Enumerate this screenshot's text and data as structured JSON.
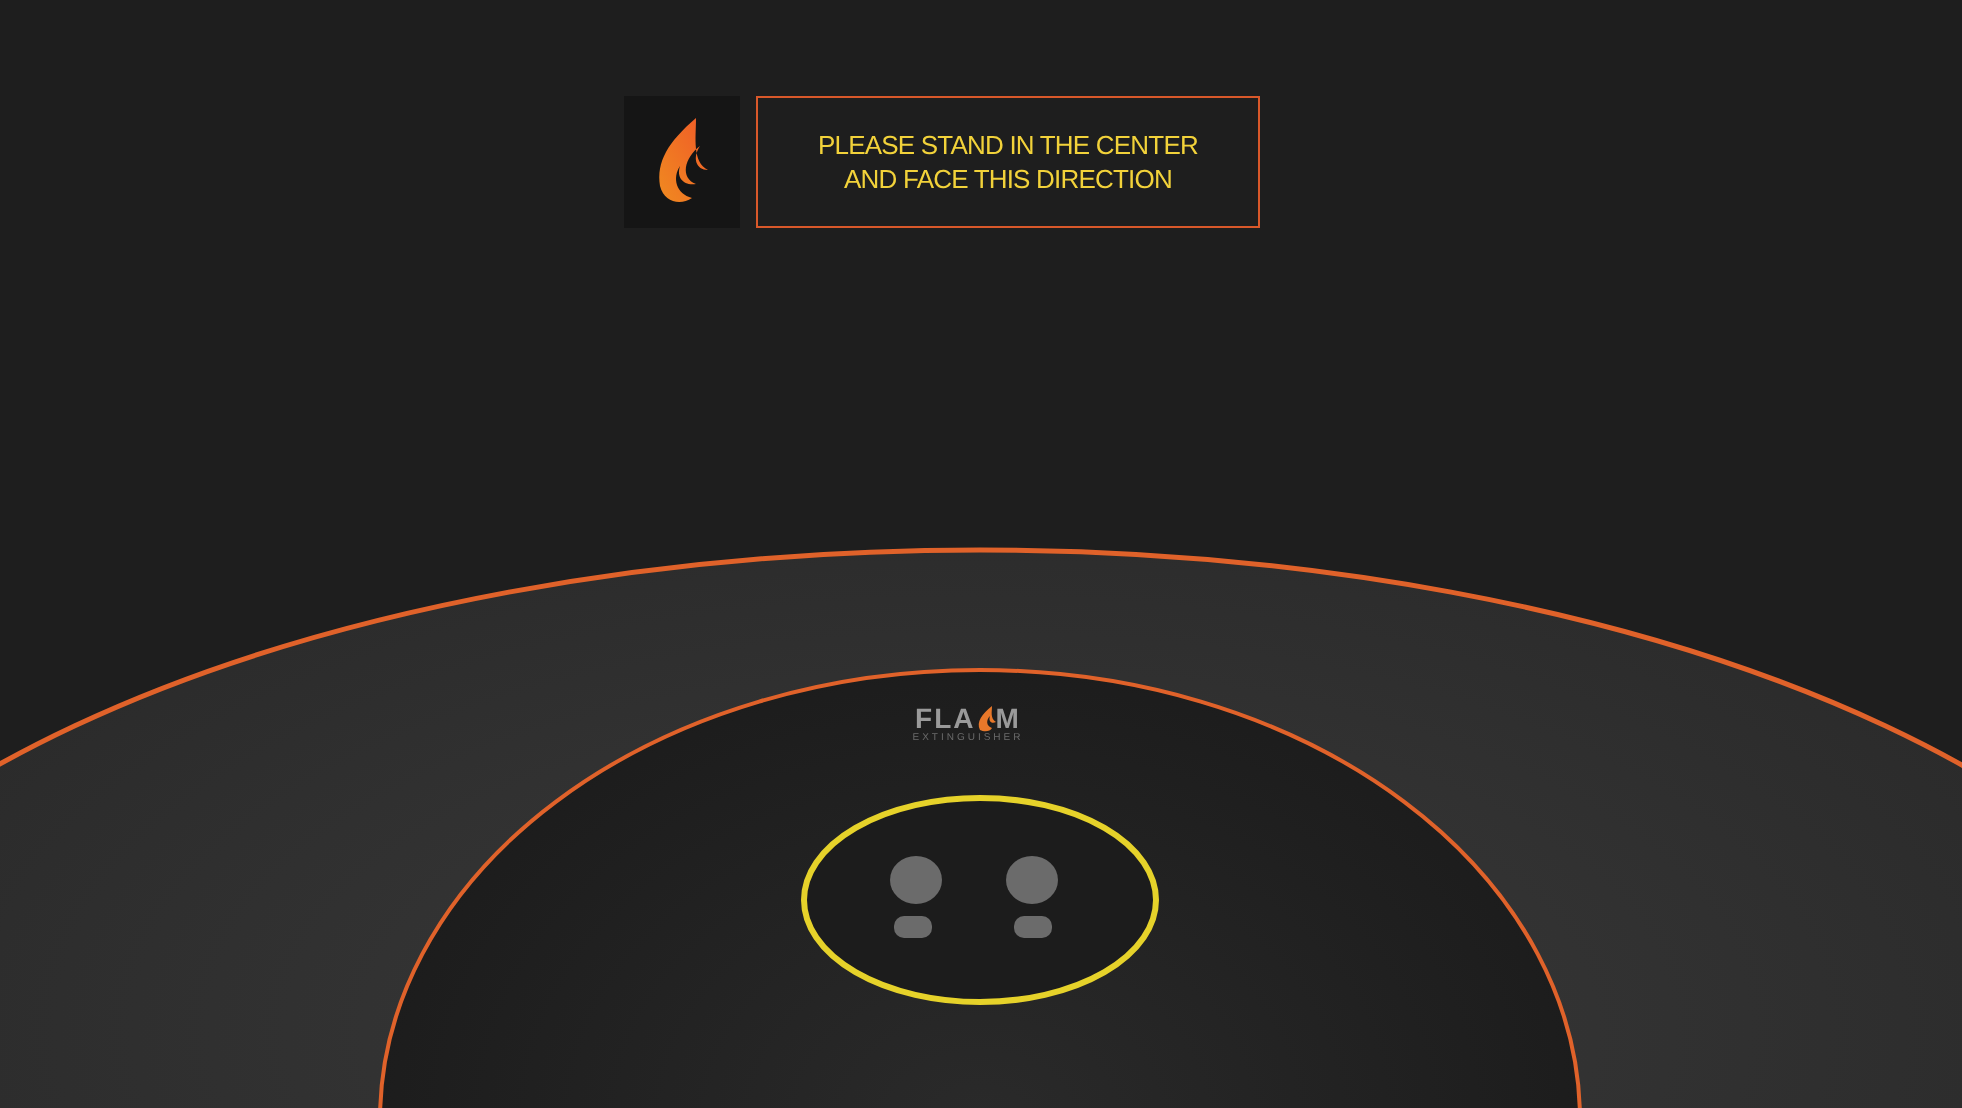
{
  "sign": {
    "lines": [
      "PLEASE STAND IN THE CENTER",
      "AND FACE THIS DIRECTION"
    ]
  },
  "floor_logo": {
    "text_before": "FLA",
    "text_after": "M",
    "subtitle": "EXTINGUISHER"
  }
}
